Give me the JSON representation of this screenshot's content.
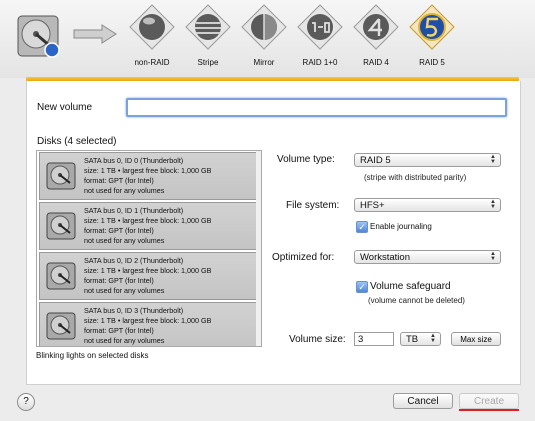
{
  "raid_levels": [
    {
      "label": "non-RAID",
      "icon": "sphere-icon"
    },
    {
      "label": "Stripe",
      "icon": "stripe-sphere-icon"
    },
    {
      "label": "Mirror",
      "icon": "mirror-sphere-icon"
    },
    {
      "label": "RAID 1+0",
      "icon": "raid10-icon"
    },
    {
      "label": "RAID 4",
      "icon": "raid4-icon"
    },
    {
      "label": "RAID 5",
      "icon": "raid5-icon",
      "selected": true
    }
  ],
  "form": {
    "new_volume_label": "New volume",
    "new_volume_value": "",
    "disks_title": "Disks (4 selected)",
    "blinking_note": "Blinking lights on selected disks",
    "volume_type_label": "Volume type:",
    "volume_type_value": "RAID 5",
    "volume_type_note": "(stripe with distributed parity)",
    "file_system_label": "File system:",
    "file_system_value": "HFS+",
    "enable_journaling_label": "Enable journaling",
    "enable_journaling_checked": true,
    "optimized_for_label": "Optimized for:",
    "optimized_for_value": "Workstation",
    "volume_safeguard_label": "Volume safeguard",
    "volume_safeguard_checked": true,
    "volume_safeguard_note": "(volume cannot be deleted)",
    "volume_size_label": "Volume size:",
    "volume_size_value": "3",
    "volume_size_unit": "TB",
    "max_size_label": "Max size"
  },
  "disks": [
    {
      "title": "SATA bus 0, ID 0 (Thunderbolt)",
      "size": "size: 1 TB • largest free block: 1,000 GB",
      "format": "format: GPT (for Intel)",
      "usage": "not used for any volumes"
    },
    {
      "title": "SATA bus 0, ID 1 (Thunderbolt)",
      "size": "size: 1 TB • largest free block: 1,000 GB",
      "format": "format: GPT (for Intel)",
      "usage": "not used for any volumes"
    },
    {
      "title": "SATA bus 0, ID 2 (Thunderbolt)",
      "size": "size: 1 TB • largest free block: 1,000 GB",
      "format": "format: GPT (for Intel)",
      "usage": "not used for any volumes"
    },
    {
      "title": "SATA bus 0, ID 3 (Thunderbolt)",
      "size": "size: 1 TB • largest free block: 1,000 GB",
      "format": "format: GPT (for Intel)",
      "usage": "not used for any volumes"
    }
  ],
  "buttons": {
    "help": "?",
    "cancel": "Cancel",
    "create": "Create"
  },
  "colors": {
    "accent": "#e7a70f",
    "selected_input": "#7aa2e0",
    "highlight": "#e02020"
  }
}
